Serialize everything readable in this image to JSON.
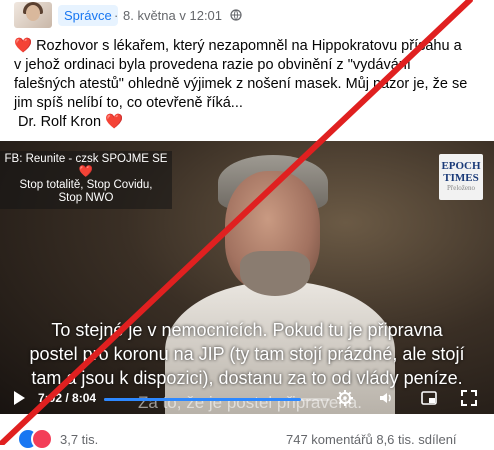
{
  "post": {
    "role_badge": "Správce",
    "separator": "·",
    "date": "8. května v 12:01",
    "text_line1": "❤️ Rozhovor s lékařem, který nezapomněl na Hippokratovu přísahu a",
    "text_line2": "v jehož ordinaci byla provedena razie po obvinění z \"vydávání",
    "text_line3": "falešných atestů\" ohledně výjimek z nošení masek. Můj názor je, že se",
    "text_line4": "jim spíš nelíbí to, co otevřeně říká...",
    "text_line5": " Dr. Rolf Kron ❤️"
  },
  "video": {
    "overlay_line1": "FB: Reunite - czsk SPOJME SE ❤️",
    "overlay_line2": "Stop totalitě, Stop Covidu,",
    "overlay_line3": "Stop NWO",
    "logo_line1": "EPOCH",
    "logo_line2": "TIMES",
    "logo_line3": "Přeloženo",
    "subtitle_line1": "To stejné je v nemocnicích. Pokud tu je připravna",
    "subtitle_line2": "postel pro koronu na JIP (ty tam stojí prázdné, ale stojí",
    "subtitle_line3": "tam a jsou k dispozici), dostanu za to od vlády peníze.",
    "subtitle_faint": "Za to, že je postel připravena.",
    "time": "7:02 / 8:04",
    "progress_fraction": 0.873
  },
  "footer": {
    "reactions_count": "3,7 tis.",
    "stats": "747 komentářů  8,6 tis. sdílení"
  },
  "colors": {
    "accent": "#1877f2",
    "cross": "#e02020"
  }
}
